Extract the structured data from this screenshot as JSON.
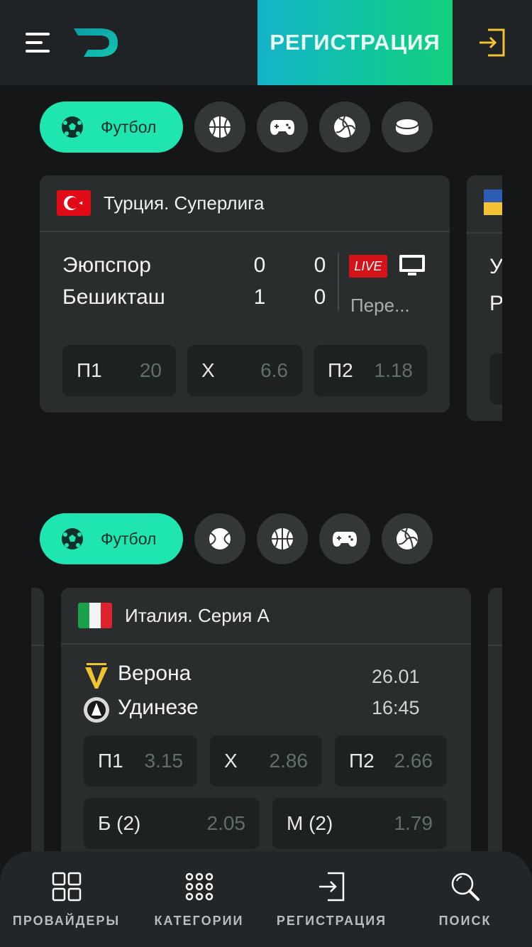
{
  "header": {
    "register_label": "РЕГИСТРАЦИЯ",
    "accent_gradient": [
      "#14b3c9",
      "#12d07b"
    ]
  },
  "section1": {
    "active_chip_label": "Футбол",
    "chips": [
      "basketball-icon",
      "gamepad-icon",
      "volleyball-icon",
      "hockey-puck-icon"
    ],
    "card": {
      "league": "Турция. Суперлига",
      "teams": [
        {
          "name": "Эюпспор",
          "score1": "0",
          "score2": "0"
        },
        {
          "name": "Бешикташ",
          "score1": "1",
          "score2": "0"
        }
      ],
      "live_label": "LIVE",
      "broadcast_label": "Пере...",
      "odds": [
        {
          "label": "П1",
          "value": "20"
        },
        {
          "label": "X",
          "value": "6.6"
        },
        {
          "label": "П2",
          "value": "1.18"
        }
      ]
    },
    "next_card_teams": [
      "У",
      "Р"
    ]
  },
  "section2": {
    "active_chip_label": "Футбол",
    "chips": [
      "tennis-ball-icon",
      "basketball-icon",
      "gamepad-icon",
      "volleyball-icon"
    ],
    "card": {
      "league": "Италия. Серия А",
      "teams": [
        {
          "name": "Верона"
        },
        {
          "name": "Удинезе"
        }
      ],
      "date": "26.01",
      "time": "16:45",
      "odds": [
        {
          "label": "П1",
          "value": "3.15"
        },
        {
          "label": "X",
          "value": "2.86"
        },
        {
          "label": "П2",
          "value": "2.66"
        }
      ],
      "totals": [
        {
          "label": "Б (2)",
          "value": "2.05"
        },
        {
          "label": "М (2)",
          "value": "1.79"
        }
      ]
    }
  },
  "bottom_nav": [
    {
      "label": "ПРОВАЙДЕРЫ",
      "icon": "grid-icon"
    },
    {
      "label": "КАТЕГОРИИ",
      "icon": "dots-grid-icon"
    },
    {
      "label": "РЕГИСТРАЦИЯ",
      "icon": "login-icon"
    },
    {
      "label": "ПОИСК",
      "icon": "search-icon"
    }
  ]
}
